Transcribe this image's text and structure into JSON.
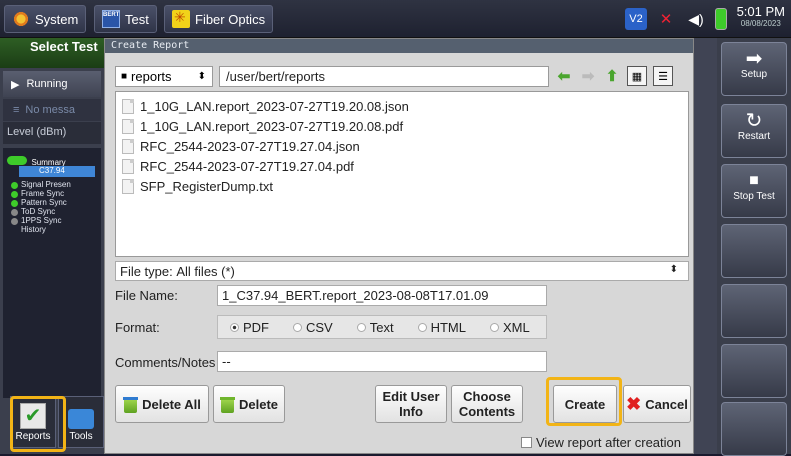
{
  "topbar": {
    "tabs": [
      {
        "label": "System",
        "icon": "gear-icon"
      },
      {
        "label": "Test",
        "icon": "bert-icon",
        "icon_text": "BERT"
      },
      {
        "label": "Fiber Optics",
        "icon": "fiber-optics-icon"
      }
    ],
    "status_icons": [
      "v2-icon",
      "no-link-icon",
      "speaker-icon",
      "battery-icon"
    ],
    "v2_label": "V2",
    "clock_time": "5:01 PM",
    "clock_date": "08/08/2023"
  },
  "left_panel": {
    "select_test": "Select Test",
    "running": "Running",
    "no_messages": "No messa",
    "level": "Level (dBm)",
    "tree": {
      "summary": "Summary",
      "selected": "C37.94",
      "items": [
        "Signal Presen",
        "Frame Sync",
        "Pattern Sync",
        "ToD Sync",
        "1PPS Sync",
        "History"
      ]
    },
    "bottom_buttons": [
      {
        "label": "Reports",
        "icon": "reports-icon"
      },
      {
        "label": "Tools",
        "icon": "tools-icon"
      }
    ]
  },
  "right_panel": {
    "buttons": [
      {
        "label": "Setup",
        "icon": "arrow-right-icon"
      },
      {
        "label": "Restart",
        "icon": "restart-icon"
      },
      {
        "label": "Stop Test",
        "icon": "stop-icon"
      }
    ]
  },
  "dialog": {
    "title": "Create Report",
    "dir_select": "reports",
    "path": "/user/bert/reports",
    "files": [
      "1_10G_LAN.report_2023-07-27T19.20.08.json",
      "1_10G_LAN.report_2023-07-27T19.20.08.pdf",
      "RFC_2544-2023-07-27T19.27.04.json",
      "RFC_2544-2023-07-27T19.27.04.pdf",
      "SFP_RegisterDump.txt"
    ],
    "file_type_label": "File type:",
    "file_type_value": "All files (*)",
    "file_name_label": "File Name:",
    "file_name_value": "1_C37.94_BERT.report_2023-08-08T17.01.09",
    "format_label": "Format:",
    "format_options": [
      "PDF",
      "CSV",
      "Text",
      "HTML",
      "XML"
    ],
    "format_selected": "PDF",
    "comments_label": "Comments/Notes",
    "comments_value": "--",
    "buttons": {
      "delete_all": "Delete All",
      "delete": "Delete",
      "edit_user_info": "Edit User Info",
      "choose_contents": "Choose Contents",
      "create": "Create",
      "cancel": "Cancel"
    },
    "view_after": "View report after creation"
  },
  "highlight_color": "#f2b416"
}
